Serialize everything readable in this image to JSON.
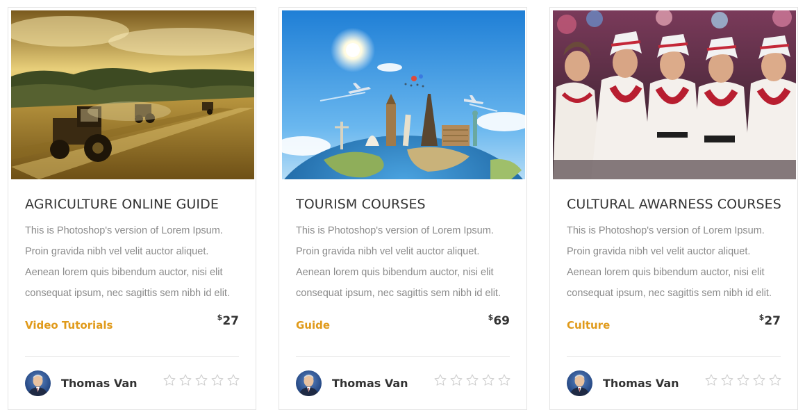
{
  "currency_symbol": "$",
  "cards": [
    {
      "title": "AGRICULTURE ONLINE GUIDE",
      "description": "This is Photoshop's version of Lorem Ipsum. Proin gravida nibh vel velit auctor aliquet. Aenean lorem quis bibendum auctor, nisi elit consequat ipsum, nec sagittis sem nibh id elit.",
      "category": "Video Tutorials",
      "price": "27",
      "author": "Thomas Van",
      "rating": 0,
      "rating_max": 5,
      "image_subject": "tractors harvesting a golden field"
    },
    {
      "title": "TOURISM COURSES",
      "description": "This is Photoshop's version of Lorem Ipsum. Proin gravida nibh vel velit auctor aliquet. Aenean lorem quis bibendum auctor, nisi elit consequat ipsum, nec sagittis sem nibh id elit.",
      "category": "Guide",
      "price": "69",
      "author": "Thomas Van",
      "rating": 0,
      "rating_max": 5,
      "image_subject": "world landmarks on a globe with airplanes"
    },
    {
      "title": "CULTURAL AWARNESS COURSES",
      "description": "This is Photoshop's version of Lorem Ipsum. Proin gravida nibh vel velit auctor aliquet. Aenean lorem quis bibendum auctor, nisi elit consequat ipsum, nec sagittis sem nibh id elit.",
      "category": "Culture",
      "price": "27",
      "author": "Thomas Van",
      "rating": 0,
      "rating_max": 5,
      "image_subject": "women in traditional folk costumes"
    }
  ],
  "colors": {
    "accent": "#e09a1a",
    "title": "#333333",
    "body_text": "#8a8a8a",
    "star_empty": "#cfcfcf",
    "border": "#e3e3e3"
  },
  "icons": {
    "star": "star-outline-icon"
  }
}
